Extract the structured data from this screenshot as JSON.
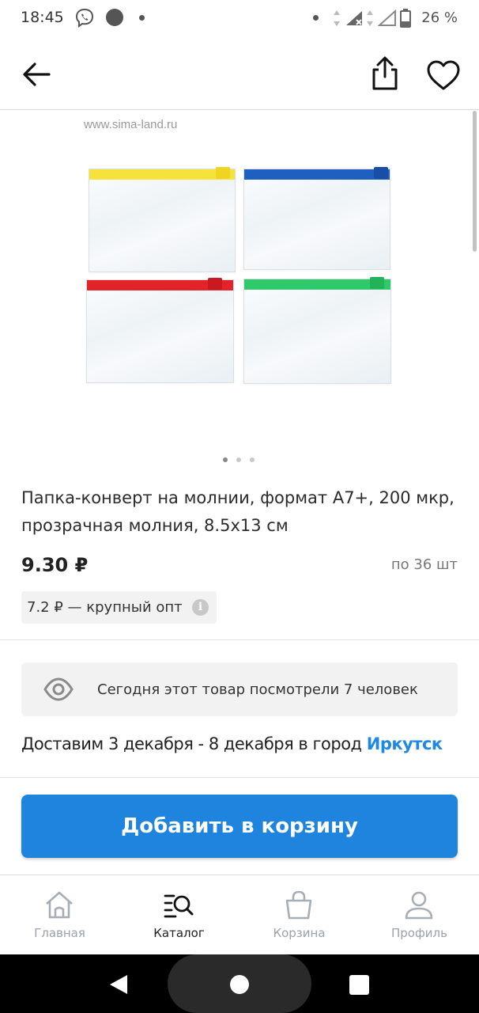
{
  "status_bar": {
    "time": "18:45",
    "battery_text": "26 %",
    "icons": [
      "viber-icon",
      "notification-circle-icon",
      "dot-icon",
      "wifi-signal-icon",
      "cell-signal-icon",
      "battery-icon"
    ]
  },
  "app_bar": {
    "back_icon": "arrow-left-icon",
    "share_icon": "share-icon",
    "favorite_icon": "heart-icon"
  },
  "product": {
    "watermark": "www.sima-land.ru",
    "image_colors": [
      "#f5e23a",
      "#1f5fbf",
      "#e2232a",
      "#2fc86a"
    ],
    "gallery_count": 3,
    "gallery_active_index": 0,
    "title": "Папка-конверт на молнии, формат А7+, 200 мкр, прозрачная молния, 8.5х13 см",
    "price": "9.30 ₽",
    "min_qty": "по 36 шт",
    "wholesale": "7.2 ₽ — крупный опт",
    "info_icon": "i"
  },
  "views": {
    "icon": "eye-icon",
    "text": "Сегодня этот товар посмотрели 7 человек"
  },
  "delivery": {
    "text": "Доставим 3 декабря - 8 декабря в город ",
    "city": "Иркутск"
  },
  "add_to_cart_label": "Добавить в корзину",
  "bottom_nav": {
    "items": [
      {
        "label": "Главная",
        "icon": "home-icon",
        "active": false
      },
      {
        "label": "Каталог",
        "icon": "catalog-search-icon",
        "active": true
      },
      {
        "label": "Корзина",
        "icon": "cart-bag-icon",
        "active": false
      },
      {
        "label": "Профиль",
        "icon": "profile-icon",
        "active": false
      }
    ]
  },
  "colors": {
    "accent": "#1f84de",
    "link": "#1e88e5"
  }
}
